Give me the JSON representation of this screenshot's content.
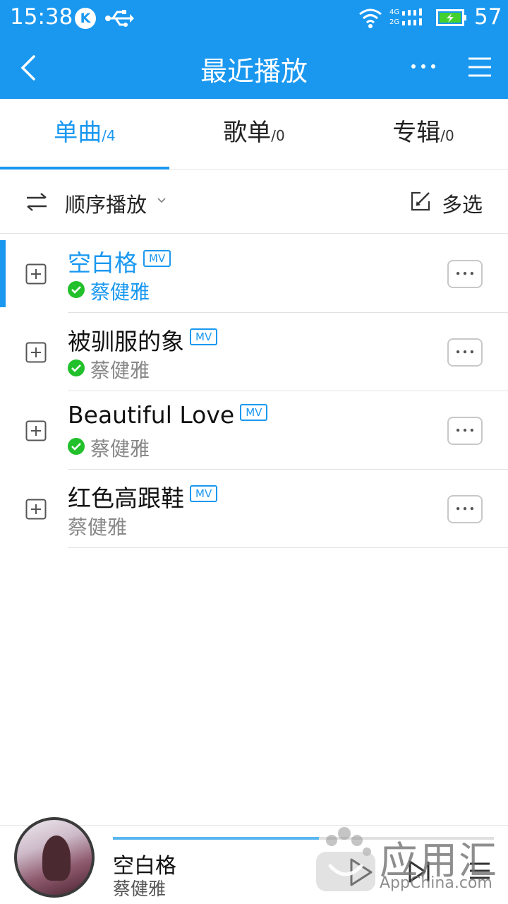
{
  "status_bar": {
    "time": "15:38",
    "net_4g": "4G",
    "net_2g": "2G",
    "battery": "57"
  },
  "toolbar": {
    "title": "最近播放"
  },
  "tabs": [
    {
      "label": "单曲",
      "count": "/4"
    },
    {
      "label": "歌单",
      "count": "/0"
    },
    {
      "label": "专辑",
      "count": "/0"
    }
  ],
  "sortbar": {
    "order_label": "顺序播放",
    "multi_select_label": "多选"
  },
  "songs": [
    {
      "title": "空白格",
      "badge": "MV",
      "artist": "蔡健雅"
    },
    {
      "title": "被驯服的象",
      "badge": "MV",
      "artist": "蔡健雅"
    },
    {
      "title": "Beautiful Love",
      "badge": "MV",
      "artist": "蔡健雅"
    },
    {
      "title": "红色高跟鞋",
      "badge": "MV",
      "artist": "蔡健雅"
    }
  ],
  "player": {
    "title": "空白格",
    "artist": "蔡健雅",
    "progress": 0.54
  },
  "watermark": {
    "name": "应用汇",
    "site": "AppChina.com"
  },
  "colors": {
    "accent": "#1a98f0",
    "downloaded_check": "#22c02a"
  }
}
